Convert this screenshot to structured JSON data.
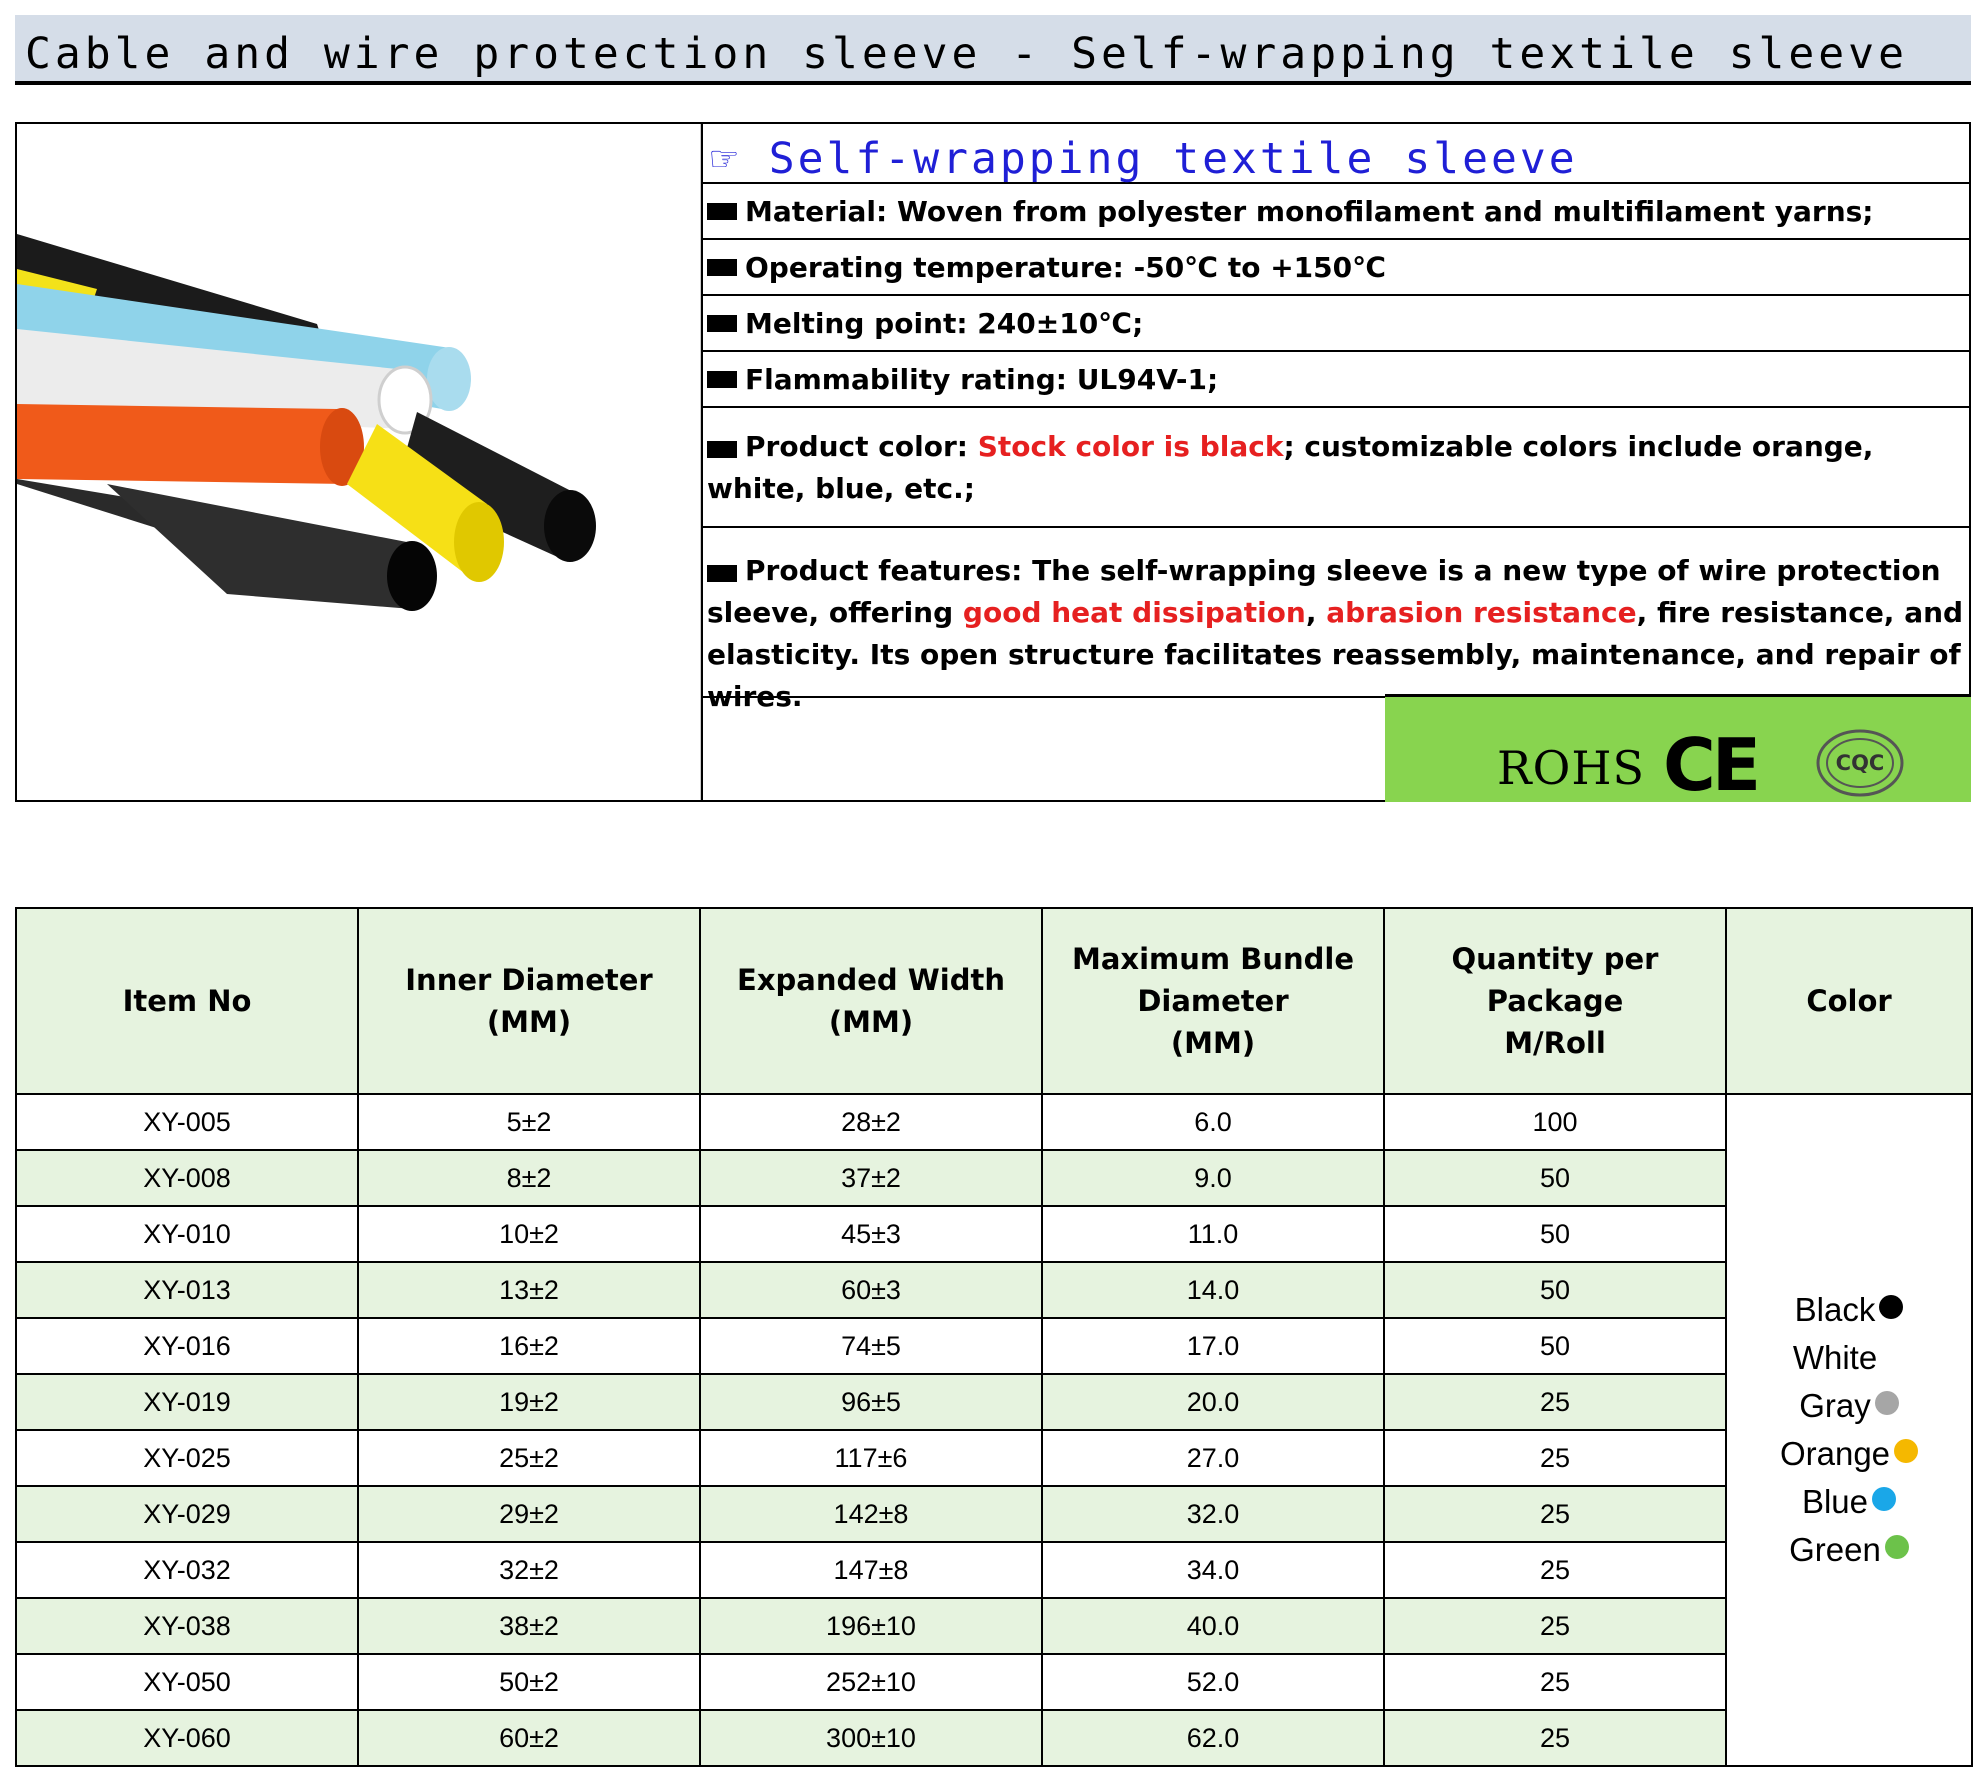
{
  "page_title": "Cable and wire protection sleeve - Self-wrapping textile sleeve",
  "product": {
    "heading_icon": "pointing-hand-icon",
    "heading": "Self-wrapping textile sleeve",
    "material": "Material: Woven from polyester monofilament and multifilament yarns;",
    "temperature": "Operating temperature: -50℃ to +150℃",
    "melting": "Melting point: 240±10℃;",
    "flammability": "Flammability rating: UL94V-1;",
    "color_label": "Product color: ",
    "color_highlight": "Stock  color is black",
    "color_rest": "; customizable colors include orange, white, blue, etc.;",
    "features_a": "Product features: The self-wrapping sleeve is a new type of wire protection sleeve, offering ",
    "features_hl1": "good heat dissipation",
    "features_sep": ", ",
    "features_hl2": "abrasion resistance",
    "features_b": ", fire resistance, and elasticity. Its open structure facilitates reassembly, maintenance, and repair of wires."
  },
  "certs": {
    "rohs": "ROHS",
    "ce": "CE",
    "cqc": "CQC",
    "bar_color": "#88d44f"
  },
  "table": {
    "headers": [
      "Item No",
      "Inner Diameter\n(MM)",
      "Expanded Width\n(MM)",
      "Maximum Bundle\nDiameter\n(MM)",
      "Quantity per Package\nM/Roll",
      "Color"
    ],
    "rows": [
      [
        "XY-005",
        "5±2",
        "28±2",
        "6.0",
        "100"
      ],
      [
        "XY-008",
        "8±2",
        "37±2",
        "9.0",
        "50"
      ],
      [
        "XY-010",
        "10±2",
        "45±3",
        "11.0",
        "50"
      ],
      [
        "XY-013",
        "13±2",
        "60±3",
        "14.0",
        "50"
      ],
      [
        "XY-016",
        "16±2",
        "74±5",
        "17.0",
        "50"
      ],
      [
        "XY-019",
        "19±2",
        "96±5",
        "20.0",
        "25"
      ],
      [
        "XY-025",
        "25±2",
        "117±6",
        "27.0",
        "25"
      ],
      [
        "XY-029",
        "29±2",
        "142±8",
        "32.0",
        "25"
      ],
      [
        "XY-032",
        "32±2",
        "147±8",
        "34.0",
        "25"
      ],
      [
        "XY-038",
        "38±2",
        "196±10",
        "40.0",
        "25"
      ],
      [
        "XY-050",
        "50±2",
        "252±10",
        "52.0",
        "25"
      ],
      [
        "XY-060",
        "60±2",
        "300±10",
        "62.0",
        "25"
      ]
    ],
    "colors": [
      {
        "name": "Black",
        "dot": "#000000"
      },
      {
        "name": "White",
        "dot": "#ffffff"
      },
      {
        "name": "Gray",
        "dot": "#a6a6a6"
      },
      {
        "name": "Orange",
        "dot": "#f5b800"
      },
      {
        "name": "Blue",
        "dot": "#1aa7e8"
      },
      {
        "name": "Green",
        "dot": "#6cc24a"
      }
    ]
  }
}
